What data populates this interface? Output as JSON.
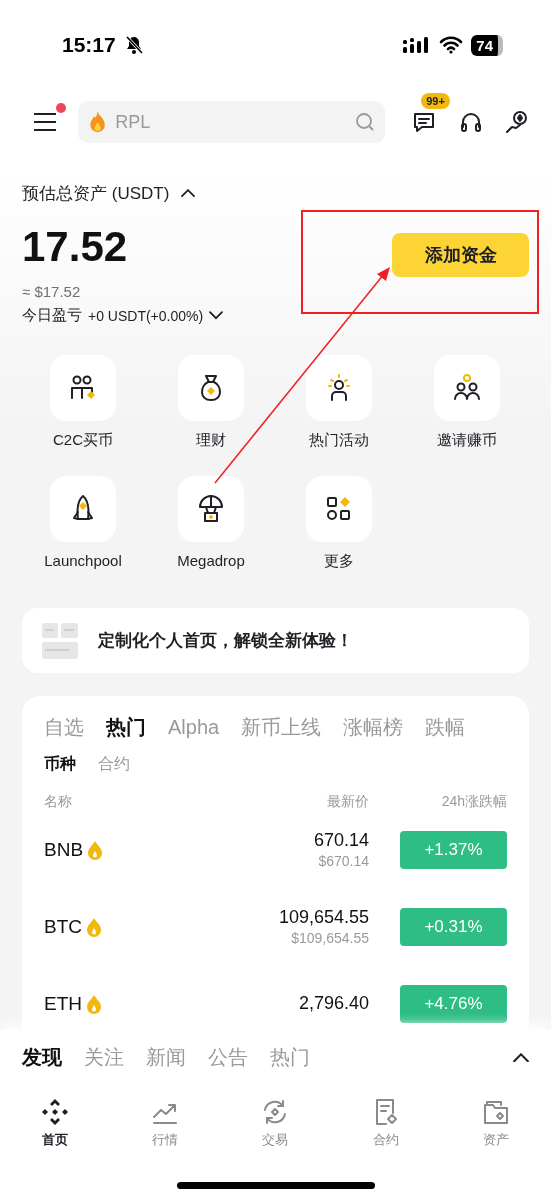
{
  "status_bar": {
    "time": "15:17",
    "battery": "74"
  },
  "top_bar": {
    "notification_dot": true,
    "search_placeholder": "RPL",
    "message_badge": "99+"
  },
  "assets": {
    "label": "预估总资产 (USDT)",
    "expanded": true,
    "total": "17.52",
    "approx": "≈ $17.52",
    "pnl_label": "今日盈亏",
    "pnl_value": "+0 USDT(+0.00%)",
    "add_funds": "添加资金"
  },
  "shortcuts": [
    {
      "kind": "c2c",
      "label": "C2C买币"
    },
    {
      "kind": "earn",
      "label": "理财"
    },
    {
      "kind": "events",
      "label": "热门活动"
    },
    {
      "kind": "invite",
      "label": "邀请赚币"
    },
    {
      "kind": "launchpool",
      "label": "Launchpool"
    },
    {
      "kind": "megadrop",
      "label": "Megadrop"
    },
    {
      "kind": "more",
      "label": "更多"
    }
  ],
  "banner": "定制化个人首页，解锁全新体验！",
  "market": {
    "tabs": [
      {
        "label": "自选",
        "selected": false
      },
      {
        "label": "热门",
        "selected": true
      },
      {
        "label": "Alpha",
        "selected": false
      },
      {
        "label": "新币上线",
        "selected": false
      },
      {
        "label": "涨幅榜",
        "selected": false
      },
      {
        "label": "跌幅",
        "selected": false
      }
    ],
    "subtabs": [
      {
        "label": "币种",
        "selected": true
      },
      {
        "label": "合约",
        "selected": false
      }
    ],
    "columns": [
      "名称",
      "最新价",
      "24h涨跌幅"
    ],
    "rows": [
      {
        "symbol": "BNB",
        "hot": true,
        "price": "670.14",
        "usd": "$670.14",
        "change": "+1.37%",
        "up": true
      },
      {
        "symbol": "BTC",
        "hot": true,
        "price": "109,654.55",
        "usd": "$109,654.55",
        "change": "+0.31%",
        "up": true
      },
      {
        "symbol": "ETH",
        "hot": true,
        "price": "2,796.40",
        "change": "+4.76%",
        "up": true
      }
    ]
  },
  "discover": {
    "expanded": false,
    "tabs": [
      {
        "label": "发现",
        "selected": true
      },
      {
        "label": "关注",
        "selected": false
      },
      {
        "label": "新闻",
        "selected": false
      },
      {
        "label": "公告",
        "selected": false
      },
      {
        "label": "热门",
        "selected": false
      }
    ]
  },
  "nav": [
    {
      "kind": "home",
      "label": "首页",
      "selected": true
    },
    {
      "kind": "markets",
      "label": "行情",
      "selected": false
    },
    {
      "kind": "trade",
      "label": "交易",
      "selected": false
    },
    {
      "kind": "futures",
      "label": "合约",
      "selected": false
    },
    {
      "kind": "assets",
      "label": "资产",
      "selected": false
    }
  ]
}
